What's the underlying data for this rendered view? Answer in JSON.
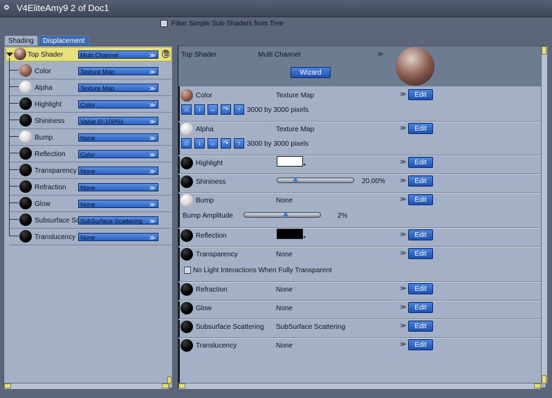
{
  "window": {
    "title": "V4EliteAmy9 2 of Doc1"
  },
  "filter": {
    "label": "Filter Simple Sub-Shaders from Tree"
  },
  "tabs": [
    {
      "label": "Shading"
    },
    {
      "label": "Displacement"
    }
  ],
  "tree": {
    "root": {
      "label": "Top Shader",
      "value": "Multi Channel",
      "icon": "sphere-top-icon"
    },
    "items": [
      {
        "label": "Color",
        "value": "Texture Map"
      },
      {
        "label": "Alpha",
        "value": "Texture Map"
      },
      {
        "label": "Highlight",
        "value": "Color"
      },
      {
        "label": "Shininess",
        "value": "Value (0-100%)"
      },
      {
        "label": "Bump",
        "value": "None"
      },
      {
        "label": "Reflection",
        "value": "Color"
      },
      {
        "label": "Transparency",
        "value": "None"
      },
      {
        "label": "Refraction",
        "value": "None"
      },
      {
        "label": "Glow",
        "value": "None"
      },
      {
        "label": "Subsurface Sc",
        "value": "SubSurface Scattering"
      },
      {
        "label": "Translucency",
        "value": "None"
      }
    ]
  },
  "detail": {
    "header": {
      "label": "Top Shader",
      "value": "Multi Channel",
      "wizard": "Wizard"
    },
    "edit_label": "Edit",
    "rows": [
      {
        "label": "Color",
        "value": "Texture Map",
        "info": "3000 by 3000 pixels"
      },
      {
        "label": "Alpha",
        "value": "Texture Map",
        "info": "3000 by 3000 pixels"
      },
      {
        "label": "Highlight",
        "swatch": "#ffffff"
      },
      {
        "label": "Shininess",
        "slider_value": "20.00%",
        "level": 0.2
      },
      {
        "label": "Bump",
        "value": "None",
        "sub_label": "Bump Amplitude",
        "sub_value": "2%",
        "sub_level": 0.5
      },
      {
        "label": "Reflection",
        "swatch": "#000000"
      },
      {
        "label": "Transparency",
        "value": "None",
        "checkbox": "No Light Interactions When Fully Transparent"
      },
      {
        "label": "Refraction",
        "value": "None"
      },
      {
        "label": "Glow",
        "value": "None"
      },
      {
        "label": "Subsurface Scattering",
        "value": "SubSurface Scattering"
      },
      {
        "label": "Translucency",
        "value": "None"
      }
    ]
  },
  "colors": {
    "selected_row": "#e8e07a",
    "button": "#2a62c4",
    "panel": "#a4b0c5"
  }
}
